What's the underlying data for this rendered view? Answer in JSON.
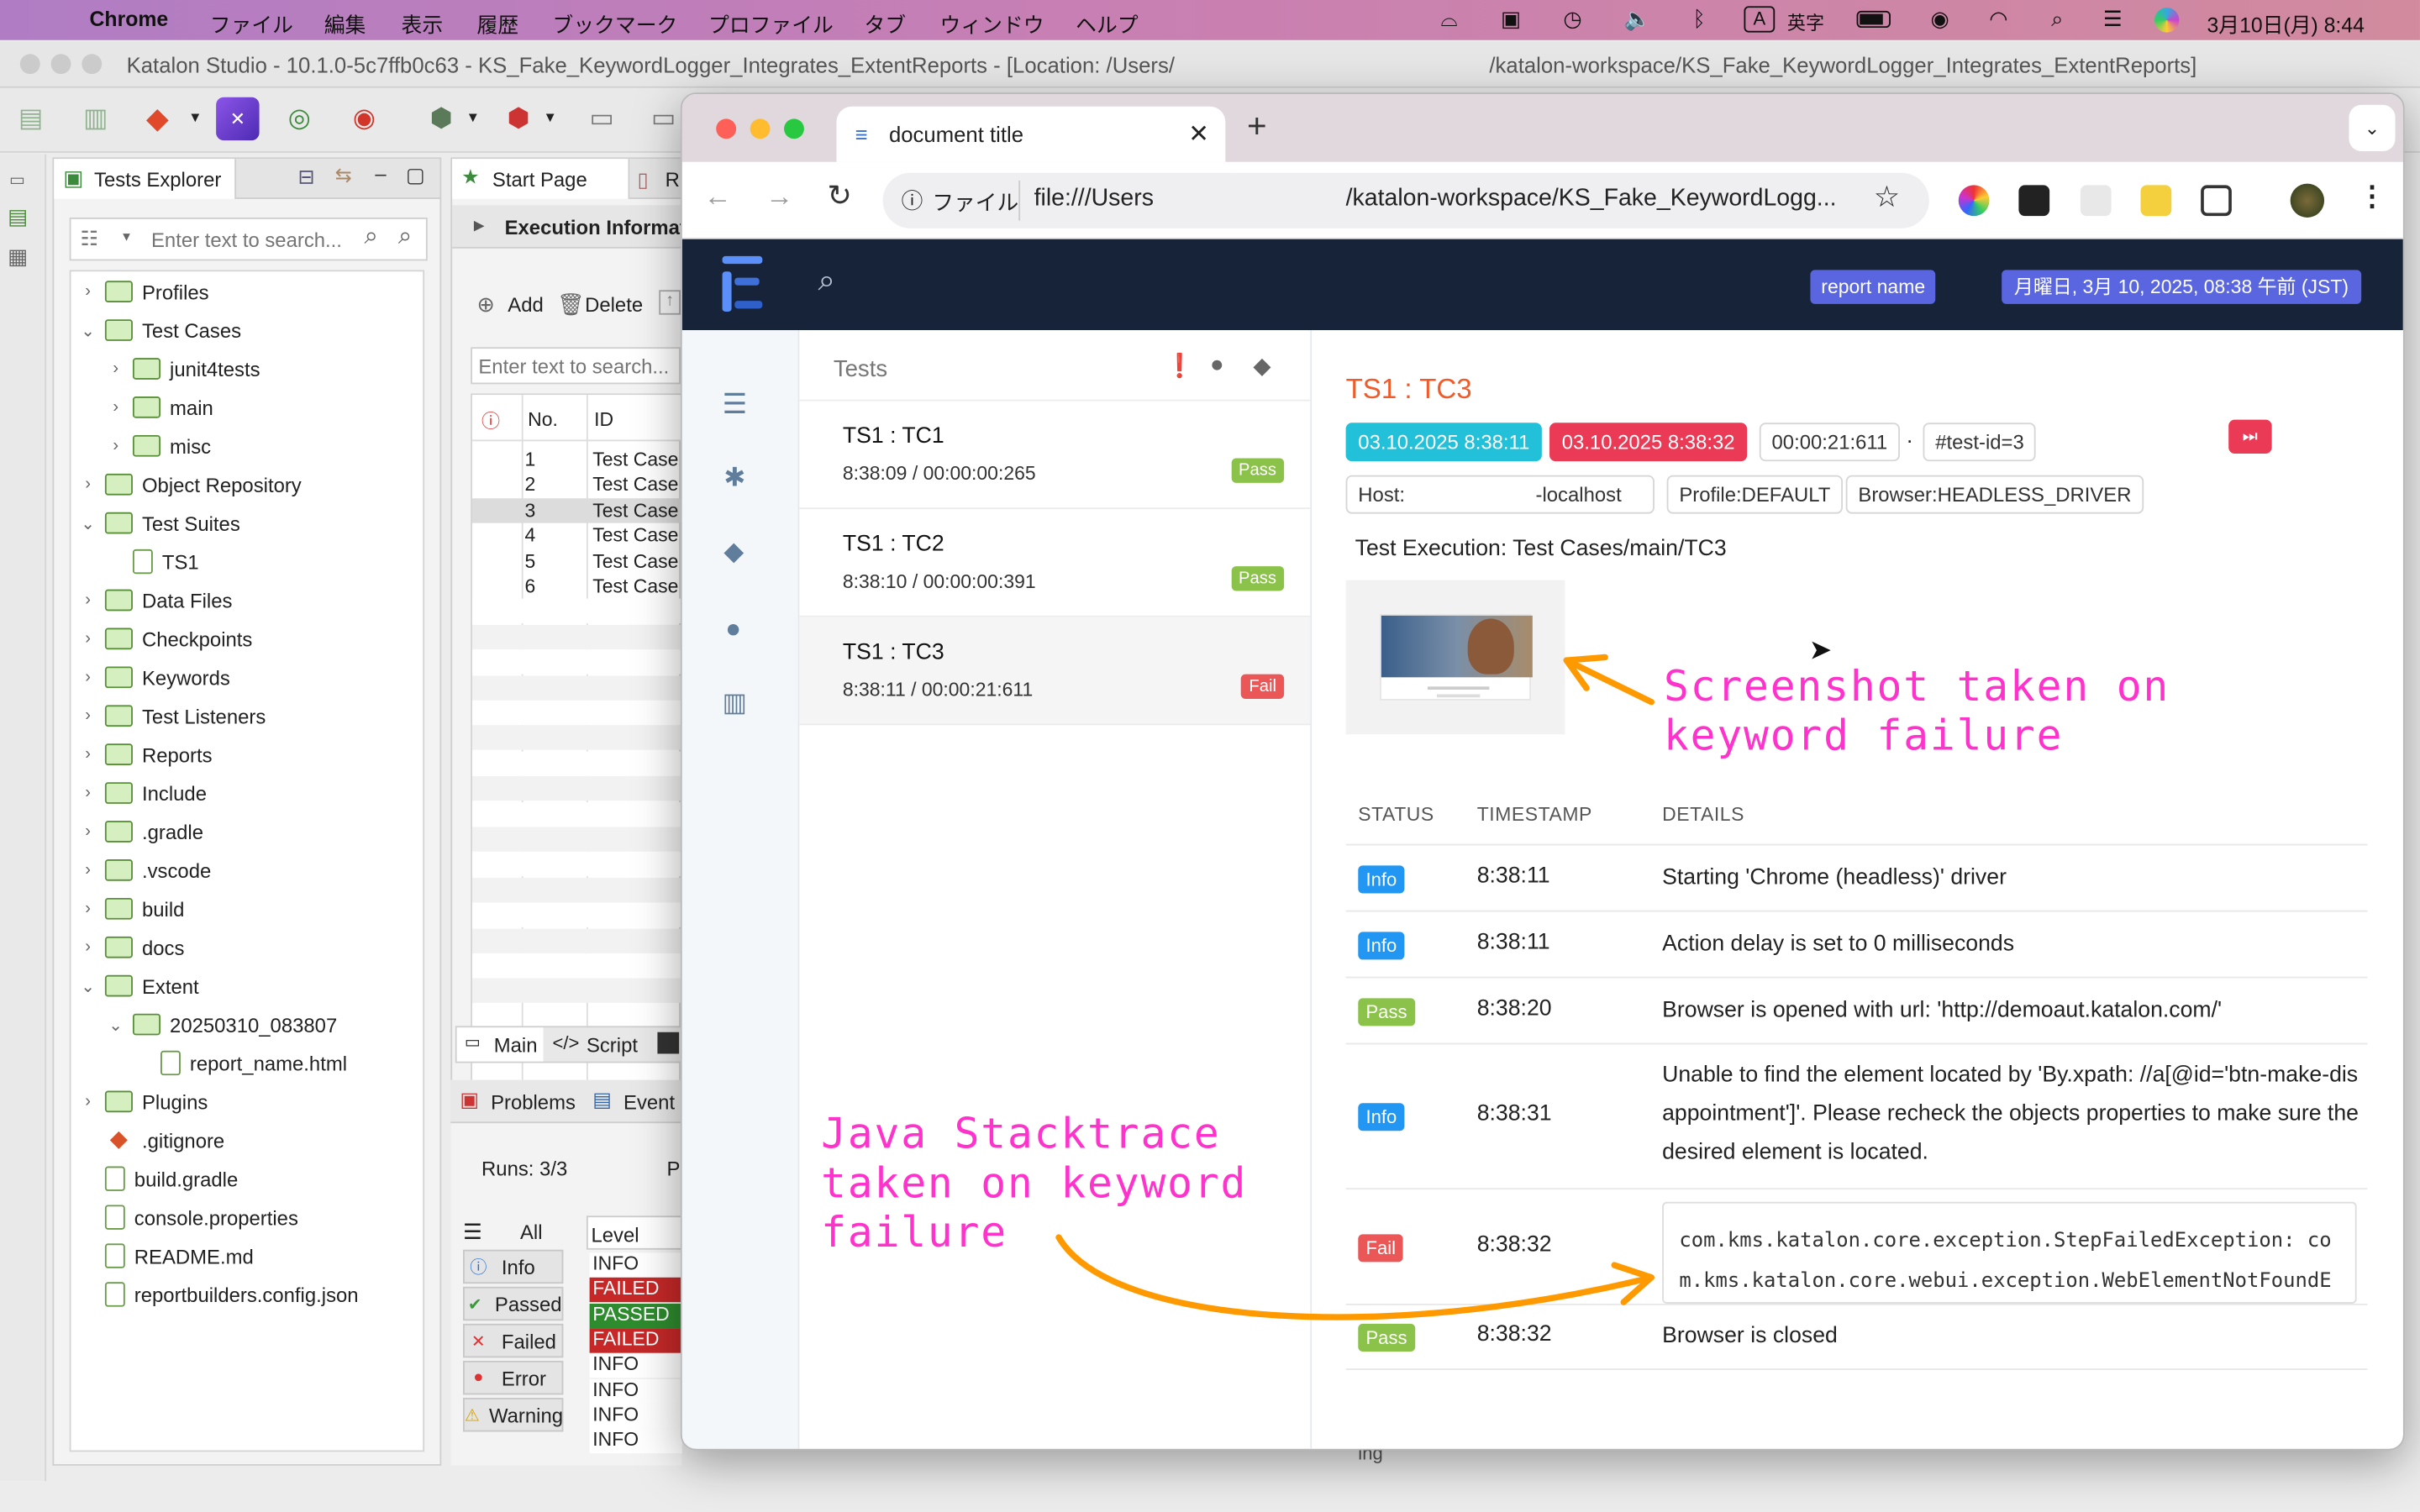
{
  "menubar": {
    "app": "Chrome",
    "items": [
      "ファイル",
      "編集",
      "表示",
      "履歴",
      "ブックマーク",
      "プロファイル",
      "タブ",
      "ウィンドウ",
      "ヘルプ"
    ],
    "input_mode": "A",
    "input_label": "英字",
    "clock": "3月10日(月)  8:44"
  },
  "katalon": {
    "window_title_left": "Katalon Studio - 10.1.0-5c7ffb0c63 - KS_Fake_KeywordLogger_Integrates_ExtentReports - [Location: /Users/",
    "window_title_right": "/katalon-workspace/KS_Fake_KeywordLogger_Integrates_ExtentReports]",
    "explorer_tab": "Tests Explorer",
    "search_placeholder": "Enter text to search...",
    "tree": [
      {
        "label": "Profiles",
        "level": 0,
        "caret": "›",
        "icon": "folder"
      },
      {
        "label": "Test Cases",
        "level": 0,
        "caret": "⌄",
        "icon": "folder"
      },
      {
        "label": "junit4tests",
        "level": 1,
        "caret": "›",
        "icon": "folder"
      },
      {
        "label": "main",
        "level": 1,
        "caret": "›",
        "icon": "folder"
      },
      {
        "label": "misc",
        "level": 1,
        "caret": "›",
        "icon": "folder"
      },
      {
        "label": "Object Repository",
        "level": 0,
        "caret": "›",
        "icon": "folder"
      },
      {
        "label": "Test Suites",
        "level": 0,
        "caret": "⌄",
        "icon": "folder"
      },
      {
        "label": "TS1",
        "level": 1,
        "caret": "",
        "icon": "doc"
      },
      {
        "label": "Data Files",
        "level": 0,
        "caret": "›",
        "icon": "folder"
      },
      {
        "label": "Checkpoints",
        "level": 0,
        "caret": "›",
        "icon": "folder"
      },
      {
        "label": "Keywords",
        "level": 0,
        "caret": "›",
        "icon": "folder"
      },
      {
        "label": "Test Listeners",
        "level": 0,
        "caret": "›",
        "icon": "folder"
      },
      {
        "label": "Reports",
        "level": 0,
        "caret": "›",
        "icon": "folder"
      },
      {
        "label": "Include",
        "level": 0,
        "caret": "›",
        "icon": "folder"
      },
      {
        "label": ".gradle",
        "level": 0,
        "caret": "›",
        "icon": "folder"
      },
      {
        "label": ".vscode",
        "level": 0,
        "caret": "›",
        "icon": "folder"
      },
      {
        "label": "build",
        "level": 0,
        "caret": "›",
        "icon": "folder"
      },
      {
        "label": "docs",
        "level": 0,
        "caret": "›",
        "icon": "folder"
      },
      {
        "label": "Extent",
        "level": 0,
        "caret": "⌄",
        "icon": "folder"
      },
      {
        "label": "20250310_083807",
        "level": 1,
        "caret": "⌄",
        "icon": "folder"
      },
      {
        "label": "report_name.html",
        "level": 2,
        "caret": "",
        "icon": "doc"
      },
      {
        "label": "Plugins",
        "level": 0,
        "caret": "›",
        "icon": "folder"
      },
      {
        "label": ".gitignore",
        "level": 0,
        "caret": "",
        "icon": "git"
      },
      {
        "label": "build.gradle",
        "level": 0,
        "caret": "",
        "icon": "doc"
      },
      {
        "label": "console.properties",
        "level": 0,
        "caret": "",
        "icon": "doc"
      },
      {
        "label": "README.md",
        "level": 0,
        "caret": "",
        "icon": "doc"
      },
      {
        "label": "reportbuilders.config.json",
        "level": 0,
        "caret": "",
        "icon": "doc"
      }
    ],
    "start_page_tab": "Start Page",
    "next_tab_partial": "R",
    "execution_header": "Execution Informat",
    "add_label": "Add",
    "delete_label": "Delete",
    "table_search_placeholder": "Enter text to search...",
    "col_no": "No.",
    "col_id": "ID",
    "rows": [
      {
        "no": "1",
        "id": "Test Case"
      },
      {
        "no": "2",
        "id": "Test Case"
      },
      {
        "no": "3",
        "id": "Test Case"
      },
      {
        "no": "4",
        "id": "Test Case"
      },
      {
        "no": "5",
        "id": "Test Case"
      },
      {
        "no": "6",
        "id": "Test Case"
      }
    ],
    "main_tab": "Main",
    "script_tab": "Script",
    "problems_tab": "Problems",
    "event_tab": "Event",
    "runs": "Runs:   3/3",
    "runs_partial": "P",
    "level_header": "Level",
    "filters": [
      "All",
      "Info",
      "Passed",
      "Failed",
      "Error",
      "Warning"
    ],
    "log_levels": [
      {
        "text": "INFO",
        "type": "info"
      },
      {
        "text": "FAILED",
        "type": "failed"
      },
      {
        "text": "PASSED",
        "type": "passed"
      },
      {
        "text": "FAILED",
        "type": "failed"
      },
      {
        "text": "INFO",
        "type": "info"
      },
      {
        "text": "INFO",
        "type": "info"
      },
      {
        "text": "INFO",
        "type": "info"
      },
      {
        "text": "INFO",
        "type": "info"
      }
    ],
    "bottom_partial": "ing"
  },
  "browser": {
    "tab_title": "document title",
    "new_tab": "+",
    "security_label": "ファイル",
    "url_left": "file:///Users",
    "url_right": "/katalon-workspace/KS_Fake_KeywordLogg..."
  },
  "report": {
    "report_name": "report name",
    "date": "月曜日, 3月 10, 2025, 08:38 午前 (JST)",
    "tests_title": "Tests",
    "tests": [
      {
        "name": "TS1 : TC1",
        "time": "8:38:09 / 00:00:00:265",
        "status": "Pass"
      },
      {
        "name": "TS1 : TC2",
        "time": "8:38:10 / 00:00:00:391",
        "status": "Pass"
      },
      {
        "name": "TS1 : TC3",
        "time": "8:38:11 / 00:00:21:611",
        "status": "Fail"
      }
    ],
    "detail": {
      "title": "TS1 : TC3",
      "start": "03.10.2025 8:38:11",
      "end": "03.10.2025 8:38:32",
      "duration": "00:00:21:611",
      "dot": "·",
      "test_id": "#test-id=3",
      "host": "Host:",
      "host_right": "-localhost",
      "profile": "Profile:DEFAULT",
      "browser": "Browser:HEADLESS_DRIVER",
      "execution": "Test Execution: Test Cases/main/TC3",
      "col_status": "STATUS",
      "col_timestamp": "TIMESTAMP",
      "col_details": "DETAILS",
      "logs": [
        {
          "status": "Info",
          "ts": "8:38:11",
          "details": "Starting 'Chrome (headless)' driver"
        },
        {
          "status": "Info",
          "ts": "8:38:11",
          "details": "Action delay is set to 0 milliseconds"
        },
        {
          "status": "Pass",
          "ts": "8:38:20",
          "details": "Browser is opened with url: 'http://demoaut.katalon.com/'"
        },
        {
          "status": "Info",
          "ts": "8:38:31",
          "details": "Unable to find the element located by 'By.xpath: //a[@id='btn-make-disappointment']'. Please recheck the objects properties to make sure the desired element is located."
        },
        {
          "status": "Fail",
          "ts": "8:38:32",
          "details": "com.kms.katalon.core.exception.StepFailedException: com.kms.katalon.core.webui.exception.WebElementNotFoundException: Web element with id: 'btn-make-disappointment' located by 'By.xpath..."
        },
        {
          "status": "Pass",
          "ts": "8:38:32",
          "details": "Browser is closed"
        }
      ]
    }
  },
  "annotations": {
    "screenshot_line1": "Screenshot taken on",
    "screenshot_line2": "keyword failure",
    "stack_line1": "Java Stacktrace",
    "stack_line2": "taken on keyword",
    "stack_line3": "failure"
  },
  "colors": {
    "annotation_text": "#ff33cc",
    "annotation_arrow": "#ff9900",
    "report_nav": "#172338",
    "fail_title": "#f15a29",
    "pass": "#8bc34a",
    "fail": "#eb5757",
    "info": "#2196f3"
  }
}
